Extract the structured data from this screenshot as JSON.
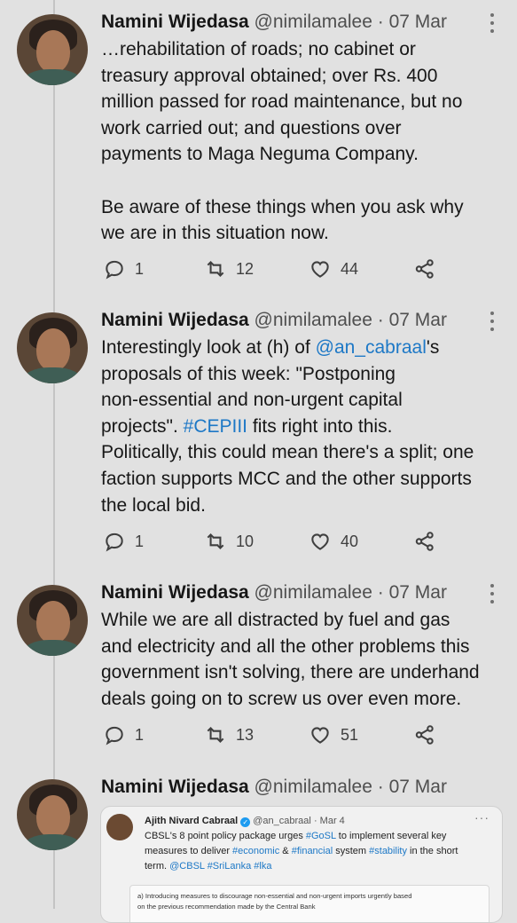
{
  "tweets": [
    {
      "name": "Namini Wijedasa",
      "handle": "@nimilamalee",
      "date": "07 Mar",
      "text_parts": [
        {
          "t": "…rehabilitation of roads; no cabinet or\ntreasury approval obtained; over Rs. 400\nmillion passed for road maintenance, but no\nwork carried out; and questions over\npayments to Maga Neguma Company.\n\nBe aware of these things when you ask why\nwe are in this situation now.",
          "link": false
        }
      ],
      "replies": "1",
      "retweets": "12",
      "likes": "44"
    },
    {
      "name": "Namini Wijedasa",
      "handle": "@nimilamalee",
      "date": "07 Mar",
      "text_parts": [
        {
          "t": "Interestingly look at (h) of ",
          "link": false
        },
        {
          "t": "@an_cabraal",
          "link": true
        },
        {
          "t": "'s\nproposals of this week: \"Postponing\nnon-essential and non-urgent capital\nprojects\". ",
          "link": false
        },
        {
          "t": "#CEPIII",
          "link": true
        },
        {
          "t": " fits right into this.\nPolitically, this could mean there's a split; one\nfaction supports MCC and the other supports\nthe local bid.",
          "link": false
        }
      ],
      "replies": "1",
      "retweets": "10",
      "likes": "40"
    },
    {
      "name": "Namini Wijedasa",
      "handle": "@nimilamalee",
      "date": "07 Mar",
      "text_parts": [
        {
          "t": "While we are all distracted by fuel and gas\nand electricity and all the other problems this\ngovernment isn't solving, there are underhand\ndeals going on to screw us over even more.",
          "link": false
        }
      ],
      "replies": "1",
      "retweets": "13",
      "likes": "51"
    },
    {
      "name": "Namini Wijedasa",
      "handle": "@nimilamalee",
      "date": "07 Mar"
    }
  ],
  "quoted": {
    "name": "Ajith Nivard Cabraal",
    "handle": "@an_cabraal",
    "date": "Mar 4",
    "more": "···",
    "text_parts": [
      {
        "t": "CBSL's 8 point policy package urges ",
        "link": false
      },
      {
        "t": "#GoSL",
        "link": true
      },
      {
        "t": " to implement several key\nmeasures to deliver ",
        "link": false
      },
      {
        "t": "#economic",
        "link": true
      },
      {
        "t": " & ",
        "link": false
      },
      {
        "t": "#financial",
        "link": true
      },
      {
        "t": " system ",
        "link": false
      },
      {
        "t": "#stability",
        "link": true
      },
      {
        "t": " in the short\nterm. ",
        "link": false
      },
      {
        "t": "@CBSL",
        "link": true
      },
      {
        "t": " ",
        "link": false
      },
      {
        "t": "#SriLanka",
        "link": true
      },
      {
        "t": " ",
        "link": false
      },
      {
        "t": "#lka",
        "link": true
      }
    ],
    "doc_text": "a)  Introducing measures to discourage non-essential and non-urgent imports urgently based\non the previous recommendation made by the Central Bank"
  },
  "colors": {
    "background": "#e1e1e1",
    "link": "#1d78c6",
    "text": "#161616"
  },
  "icons": [
    "reply-icon",
    "retweet-icon",
    "like-icon",
    "share-icon",
    "more-icon",
    "verified-icon"
  ]
}
